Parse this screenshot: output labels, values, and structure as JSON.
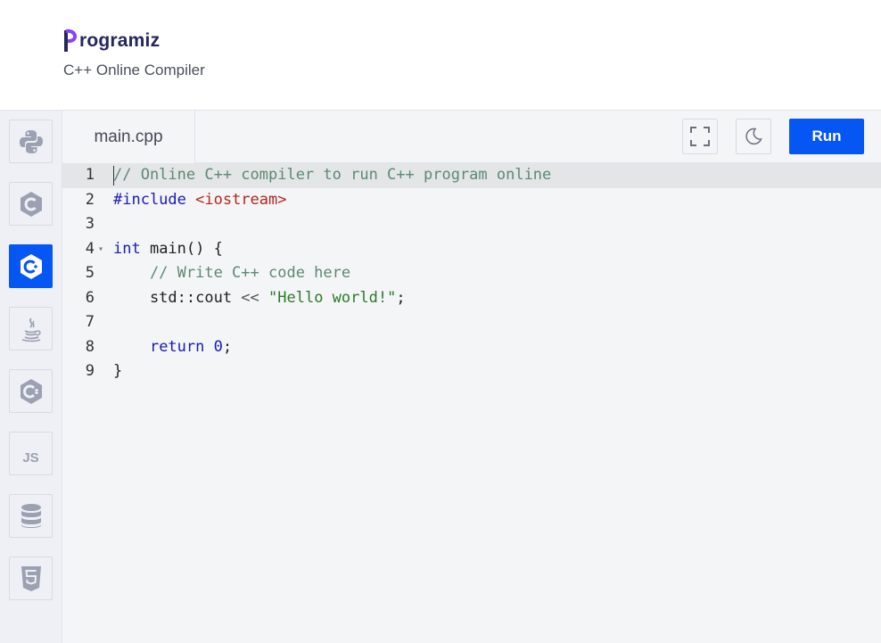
{
  "brand": {
    "logo_text": "rogramiz",
    "logo_initial": "P",
    "subtitle": "C++ Online Compiler",
    "logo_color": "#25265e",
    "accent": "#8a3ffc"
  },
  "sidebar": {
    "items": [
      {
        "name": "python",
        "icon": "python-icon",
        "active": false
      },
      {
        "name": "c",
        "icon": "c-icon",
        "active": false
      },
      {
        "name": "cpp",
        "icon": "cpp-icon",
        "active": true
      },
      {
        "name": "java",
        "icon": "java-icon",
        "active": false
      },
      {
        "name": "csharp",
        "icon": "csharp-icon",
        "active": false
      },
      {
        "name": "javascript",
        "icon": "js-icon",
        "label": "JS",
        "active": false
      },
      {
        "name": "sql",
        "icon": "database-icon",
        "active": false
      },
      {
        "name": "html",
        "icon": "html5-icon",
        "active": false
      }
    ]
  },
  "toolbar": {
    "file_tab": "main.cpp",
    "fullscreen_icon": "fullscreen-icon",
    "theme_icon": "moon-icon",
    "run_label": "Run",
    "run_color": "#0556f3"
  },
  "editor": {
    "lines": [
      {
        "num": "1"
      },
      {
        "num": "2"
      },
      {
        "num": "3"
      },
      {
        "num": "4"
      },
      {
        "num": "5"
      },
      {
        "num": "6"
      },
      {
        "num": "7"
      },
      {
        "num": "8"
      },
      {
        "num": "9"
      }
    ],
    "tokens": {
      "l1_comment": "// Online C++ compiler to run C++ program online",
      "l2_directive": "#include ",
      "l2_header": "<iostream>",
      "l4_kw": "int",
      "l4_rest": " main() {",
      "l5_comment": "    // Write C++ code here",
      "l6_pre": "    std::cout ",
      "l6_op": "<<",
      "l6_sp": " ",
      "l6_str": "\"Hello world!\"",
      "l6_end": ";",
      "l8_pre": "    ",
      "l8_kw": "return",
      "l8_sp": " ",
      "l8_num": "0",
      "l8_end": ";",
      "l9": "}"
    }
  }
}
